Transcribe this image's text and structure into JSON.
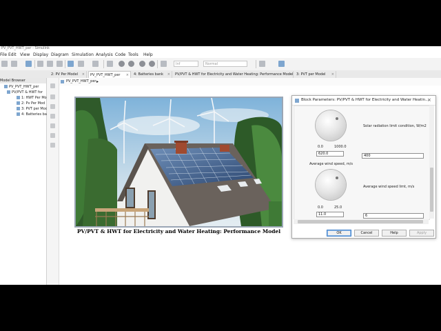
{
  "window": {
    "title": "PV_PVT_HWT_per - Simulink"
  },
  "menu": [
    "File",
    "Edit",
    "View",
    "Display",
    "Diagram",
    "Simulation",
    "Analysis",
    "Code",
    "Tools",
    "Help"
  ],
  "toolbar": {
    "stop_time": "Inf",
    "mode": "Normal"
  },
  "tabs": [
    {
      "label": "2: PV Per Model"
    },
    {
      "label": "PV_PVT_HWT_per"
    },
    {
      "label": "4: Batteries bank"
    },
    {
      "label": "PV/PVT & HWT for Electricity and Water Heating: Performance Model"
    },
    {
      "label": "3: PVT per Model"
    }
  ],
  "browser": {
    "header": "Model Browser",
    "items": [
      {
        "label": "PV_PVT_HWT_per"
      },
      {
        "label": "PV/PVT & HWT for"
      },
      {
        "label": "1: HWT Per Mo"
      },
      {
        "label": "2: Pv Per Mod"
      },
      {
        "label": "3: PVT per Mod"
      },
      {
        "label": "4: Batteries ba"
      }
    ]
  },
  "address": {
    "path": "PV_PVT_HWT_per"
  },
  "canvas": {
    "caption": "PV/PVT & HWT for Electricity and Water Heating: Performance Model"
  },
  "dialog": {
    "title": "Block Parameters: PV/PVT & HWT for Electricity and Water Heatin...",
    "knob1": {
      "min": "0.0",
      "max": "1000.0",
      "value": "620.0"
    },
    "solar_label": "Solar radiation limit condition, W/m2",
    "solar_value": "400",
    "wind_label": "Average wind speed, m/s",
    "knob2": {
      "min": "0.0",
      "max": "25.0",
      "value": "11.0"
    },
    "wind_limit_label": "Average wind speed limt, m/s",
    "wind_limit_value": "6",
    "buttons": {
      "ok": "OK",
      "cancel": "Cancel",
      "help": "Help",
      "apply": "Apply"
    }
  },
  "colors": {
    "dialog_accent": "#3c7fcb",
    "background": "#000000"
  }
}
